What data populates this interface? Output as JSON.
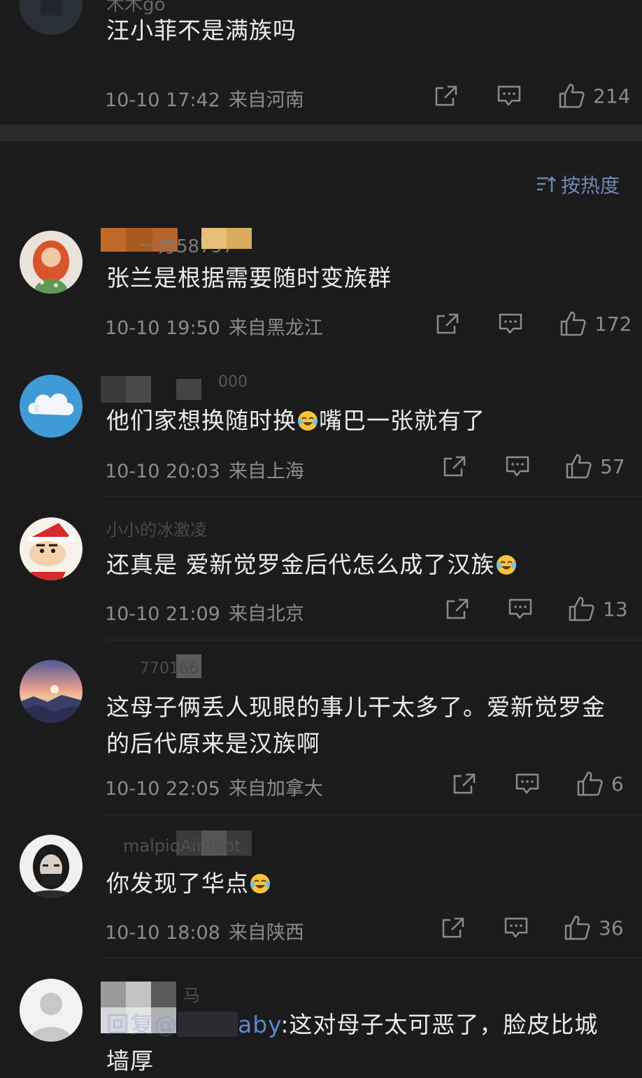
{
  "top_comment": {
    "username": "木木go",
    "text": "汪小菲不是满族吗",
    "time": "10-10 17:42",
    "location": "来自河南",
    "likes": "214"
  },
  "sort": {
    "label": "按热度"
  },
  "comments": [
    {
      "username": "一方58797",
      "text": "张兰是根据需要随时变族群",
      "time": "10-10 19:50",
      "location": "来自黑龙江",
      "likes": "172"
    },
    {
      "username": "000",
      "text_before": "他们家想换随时换",
      "text_after": "嘴巴一张就有了",
      "time": "10-10 20:03",
      "location": "来自上海",
      "likes": "57"
    },
    {
      "username": "小小的冰激凌",
      "text": "还真是 爱新觉罗金后代怎么成了汉族",
      "time": "10-10 21:09",
      "location": "来自北京",
      "likes": "13"
    },
    {
      "username": "770166",
      "text": "这母子俩丢人现眼的事儿干太多了。爱新觉罗金的后代原来是汉族啊",
      "time": "10-10 22:05",
      "location": "来自加拿大",
      "likes": "6"
    },
    {
      "username": "malpiqAirobot",
      "text": "你发现了华点",
      "time": "10-10 18:08",
      "location": "来自陕西",
      "likes": "36"
    },
    {
      "username": "马",
      "reply_prefix": "回复@",
      "reply_handle": "aby",
      "text": ":这对母子太可恶了，脸皮比城墙厚"
    }
  ]
}
